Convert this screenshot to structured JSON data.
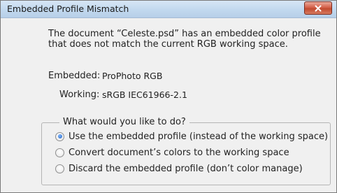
{
  "dialog": {
    "title": "Embedded Profile Mismatch",
    "message": "The document “Celeste.psd” has an embedded color profile that does not match the current RGB working space.",
    "embedded_label": "Embedded:",
    "embedded_value": "ProPhoto RGB",
    "working_label": "Working:",
    "working_value": "sRGB IEC61966-2.1",
    "group_legend": "What would you like to do?",
    "options": [
      {
        "label": "Use the embedded profile (instead of the working space)",
        "checked": true
      },
      {
        "label": "Convert document’s colors to the working space",
        "checked": false
      },
      {
        "label": "Discard the embedded profile (don’t color manage)",
        "checked": false
      }
    ]
  },
  "icons": {
    "close": "close-x-icon",
    "radio": "radio-button-icon"
  },
  "colors": {
    "titlebar": "#c3d9ef",
    "close_button": "#c14b30",
    "dialog_bg": "#f0f0f0"
  }
}
